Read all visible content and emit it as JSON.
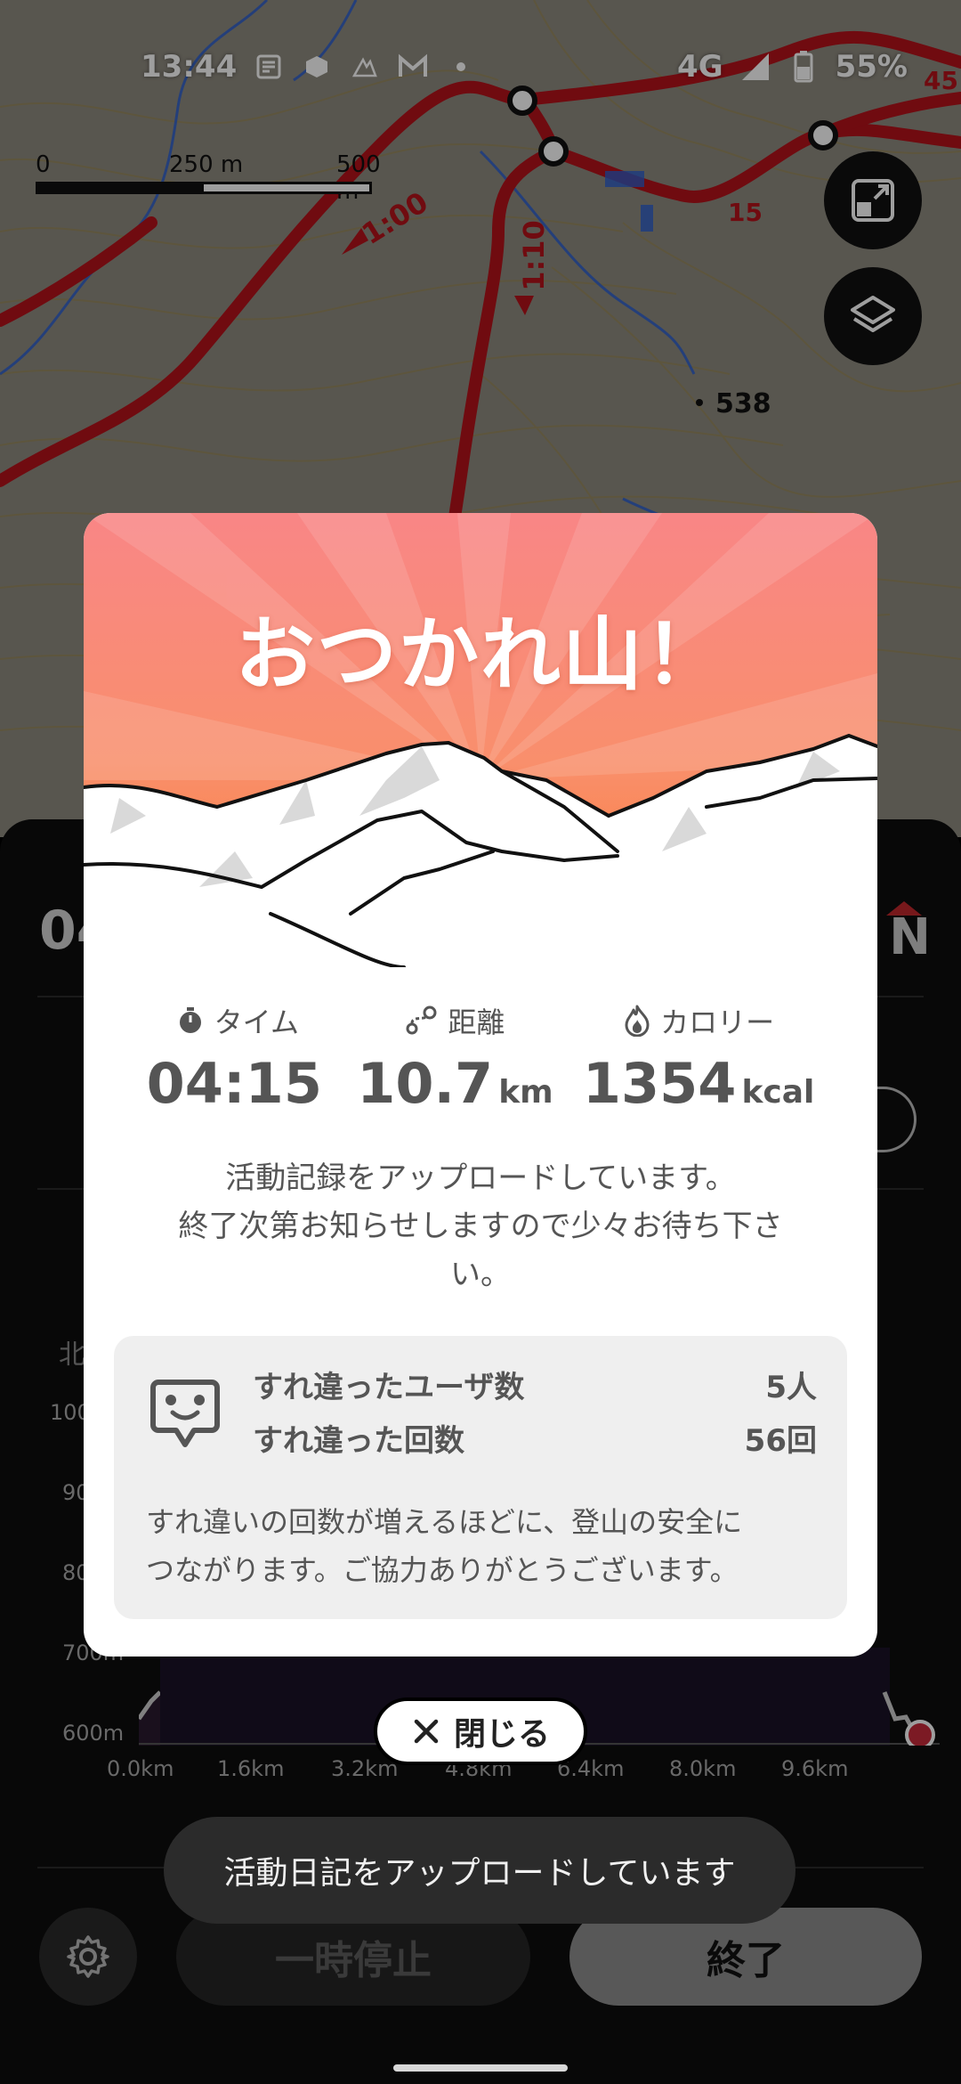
{
  "status_bar": {
    "time": "13:44",
    "network": "4G",
    "battery": "55%"
  },
  "map": {
    "scale_labels": [
      "0",
      "250 m",
      "500 m"
    ],
    "route_times": [
      "1:00",
      "1:10"
    ],
    "spot_height": "538",
    "route_numbers": [
      "15",
      "45"
    ]
  },
  "panel": {
    "elapsed_preview": "04",
    "logo_letter": "N",
    "north_label": "北",
    "elevation_y_ticks": [
      "1000m",
      "900m",
      "800m",
      "700m",
      "600m"
    ],
    "elevation_x_ticks": [
      "0.0km",
      "1.6km",
      "3.2km",
      "4.8km",
      "6.4km",
      "8.0km",
      "9.6km"
    ],
    "settings_icon": "gear-icon",
    "pause_label": "一時停止",
    "end_label": "終了"
  },
  "dialog": {
    "title": "おつかれ山！",
    "stats": [
      {
        "icon": "stopwatch-icon",
        "label": "タイム",
        "value": "04:15",
        "unit": ""
      },
      {
        "icon": "route-icon",
        "label": "距離",
        "value": "10.7",
        "unit": "km"
      },
      {
        "icon": "flame-icon",
        "label": "カロリー",
        "value": "1354",
        "unit": "kcal"
      }
    ],
    "message_line1": "活動記録をアップロードしています。",
    "message_line2": "終了次第お知らせしますので少々お待ち下さ",
    "message_line3": "い。",
    "encounter": {
      "users_label": "すれ違ったユーザ数",
      "users_value": "5人",
      "count_label": "すれ違った回数",
      "count_value": "56回",
      "note_line1": "すれ違いの回数が増えるほどに、登山の安全に",
      "note_line2": "つながります。ご協力ありがとうございます。"
    }
  },
  "close_button": {
    "label": "閉じる"
  },
  "toast": {
    "text": "活動日記をアップロードしています"
  }
}
